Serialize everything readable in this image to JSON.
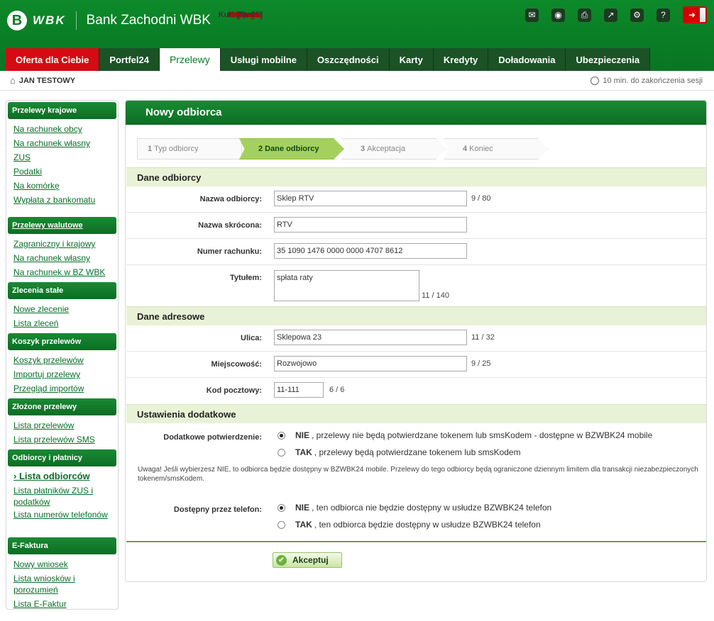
{
  "header": {
    "logo_mark": "B",
    "logo_text": "WBK",
    "bank_name": "Bank Zachodni WBK",
    "topnav": [
      {
        "label": "Poczta",
        "icon": "mail-icon",
        "glyph": "✉"
      },
      {
        "label": "Demo",
        "icon": "demo-icon",
        "glyph": "◉"
      },
      {
        "label": "Drukuj",
        "icon": "printer-icon",
        "glyph": "⎙"
      },
      {
        "label": "Kursy walut",
        "icon": "chart-icon",
        "glyph": "↗"
      },
      {
        "label": "Mój profil",
        "icon": "gear-icon",
        "glyph": "⚙"
      },
      {
        "label": "Pomoc",
        "icon": "help-icon",
        "glyph": "?"
      }
    ],
    "logout": {
      "label": "Wyloguj",
      "glyph": "➜"
    }
  },
  "tabs": [
    "Oferta dla Ciebie",
    "Portfel24",
    "Przelewy",
    "Usługi mobilne",
    "Oszczędności",
    "Karty",
    "Kredyty",
    "Doładowania",
    "Ubezpieczenia"
  ],
  "userbar": {
    "user": "JAN TESTOWY",
    "session": "10 min. do zakończenia sesji"
  },
  "sidebar": [
    {
      "title": "Przelewy krajowe",
      "items": [
        "Na rachunek obcy",
        "Na rachunek własny",
        "ZUS",
        "Podatki",
        "Na komórkę",
        "Wypłata z bankomatu"
      ]
    },
    {
      "title": "Przelewy walutowe",
      "items": [
        "Zagraniczny i krajowy",
        "Na rachunek własny",
        "Na rachunek w BZ WBK"
      ]
    },
    {
      "title": "Zlecenia stałe",
      "items": [
        "Nowe zlecenie",
        "Lista zleceń"
      ]
    },
    {
      "title": "Koszyk przelewów",
      "items": [
        "Koszyk przelewów",
        "Importuj przelewy",
        "Przegląd importów"
      ]
    },
    {
      "title": "Złożone przelewy",
      "items": [
        "Lista przelewów",
        "Lista przelewów SMS"
      ]
    },
    {
      "title": "Odbiorcy i płatnicy",
      "items": [
        "Lista odbiorców",
        "Lista płatników ZUS i podatków",
        "Lista numerów telefonów"
      ]
    },
    {
      "title": "E-Faktura",
      "items": [
        "Nowy wniosek",
        "Lista wniosków i porozumień",
        "Lista E-Faktur"
      ]
    }
  ],
  "panel": {
    "title": "Nowy odbiorca",
    "steps": [
      {
        "num": "1",
        "label": "Typ odbiorcy"
      },
      {
        "num": "2",
        "label": "Dane odbiorcy"
      },
      {
        "num": "3",
        "label": "Akceptacja"
      },
      {
        "num": "4",
        "label": "Koniec"
      }
    ],
    "sections": {
      "recipient": "Dane odbiorcy",
      "address": "Dane adresowe",
      "extra": "Ustawienia dodatkowe"
    },
    "fields": {
      "name": {
        "label": "Nazwa odbiorcy:",
        "value": "Sklep RTV",
        "count": "9 / 80"
      },
      "short": {
        "label": "Nazwa skrócona:",
        "value": "RTV"
      },
      "account": {
        "label": "Numer rachunku:",
        "value": "35 1090 1476 0000 0000 4707 8612"
      },
      "title": {
        "label": "Tytułem:",
        "value": "spłata raty",
        "count": "11 / 140"
      },
      "street": {
        "label": "Ulica:",
        "value": "Sklepowa 23",
        "count": "11 / 32"
      },
      "city": {
        "label": "Miejscowość:",
        "value": "Rozwojowo",
        "count": "9 / 25"
      },
      "zip": {
        "label": "Kod pocztowy:",
        "value": "11-111",
        "count": "6 / 6"
      }
    },
    "confirm": {
      "label": "Dodatkowe potwierdzenie:",
      "options": [
        {
          "key": "NIE",
          "text": ", przelewy nie będą potwierdzane tokenem lub smsKodem - dostępne w BZWBK24 mobile"
        },
        {
          "key": "TAK",
          "text": ", przelewy będą potwierdzane tokenem lub smsKodem"
        }
      ]
    },
    "note": "Uwaga! Jeśli wybierzesz NIE, to odbiorca będzie dostępny w BZWBK24 mobile. Przelewy do tego odbiorcy będą ograniczone dziennym limitem dla transakcji niezabezpieczonych tokenem/smsKodem.",
    "phone": {
      "label": "Dostępny przez telefon:",
      "options": [
        {
          "key": "NIE",
          "text": ", ten odbiorca nie będzie dostępny w usłudze BZWBK24 telefon"
        },
        {
          "key": "TAK",
          "text": ", ten odbiorca będzie dostępny w usłudze BZWBK24 telefon"
        }
      ]
    },
    "accept": "Akceptuj"
  }
}
